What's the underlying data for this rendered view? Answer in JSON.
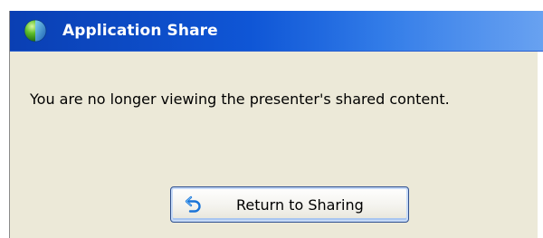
{
  "window": {
    "title": "Application Share",
    "title_icon": "globe-icon",
    "colors": {
      "titlebar_dark": "#0a3fb3",
      "titlebar_light": "#5f9cf0",
      "body_background": "#ece9d8"
    }
  },
  "content": {
    "message": "You are no longer viewing the presenter's shared content."
  },
  "button": {
    "label": "Return to Sharing",
    "icon": "return-arrow-icon"
  }
}
